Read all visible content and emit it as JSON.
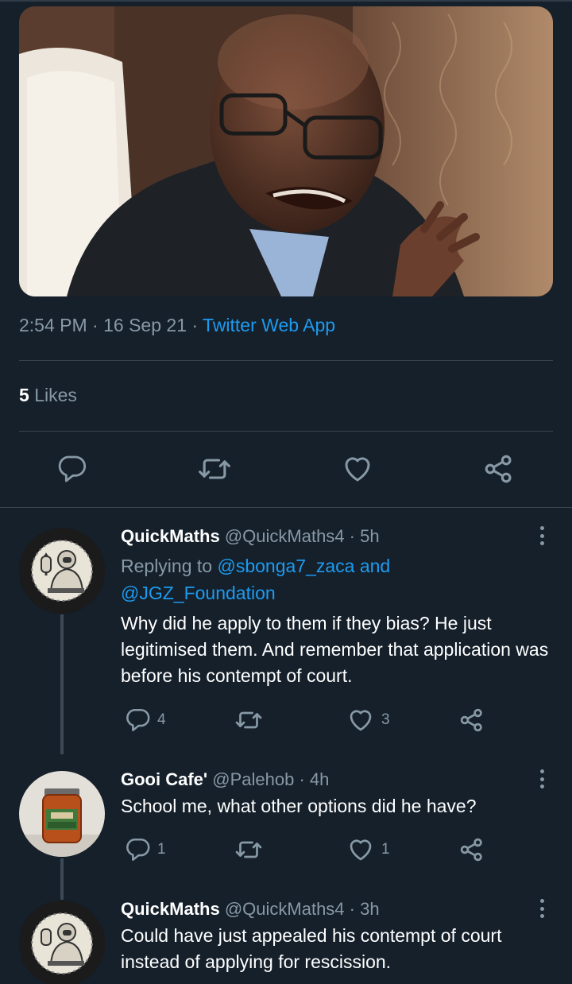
{
  "tweet": {
    "time": "2:54 PM",
    "date": "16 Sep 21",
    "separator": "·",
    "app": "Twitter Web App",
    "likes_count": "5",
    "likes_label": "Likes"
  },
  "replies": [
    {
      "name": "QuickMaths",
      "handle": "@QuickMaths4",
      "time": "· 5h",
      "replying_prefix": "Replying to",
      "replying_to_1": "@sbonga7_zaca",
      "replying_and": "and",
      "replying_to_2": "@JGZ_Foundation",
      "text": "Why did he apply to them if they bias? He just legitimised them. And remember that application was before his contempt of court.",
      "reply_count": "4",
      "retweet_count": "",
      "like_count": "3"
    },
    {
      "name": "Gooi Cafe'",
      "handle": "@Palehob",
      "time": "· 4h",
      "text": "School me, what other options did he have?",
      "reply_count": "1",
      "retweet_count": "",
      "like_count": "1"
    },
    {
      "name": "QuickMaths",
      "handle": "@QuickMaths4",
      "time": "· 3h",
      "text": "Could have just appealed his contempt of court instead of applying for rescission."
    }
  ],
  "icons": {
    "reply": "reply-icon",
    "retweet": "retweet-icon",
    "like": "like-icon",
    "share": "share-icon",
    "more": "more-icon"
  },
  "colors": {
    "background": "#15202b",
    "link": "#1d9bf0",
    "muted": "#8899a6",
    "divider": "#38444d"
  }
}
